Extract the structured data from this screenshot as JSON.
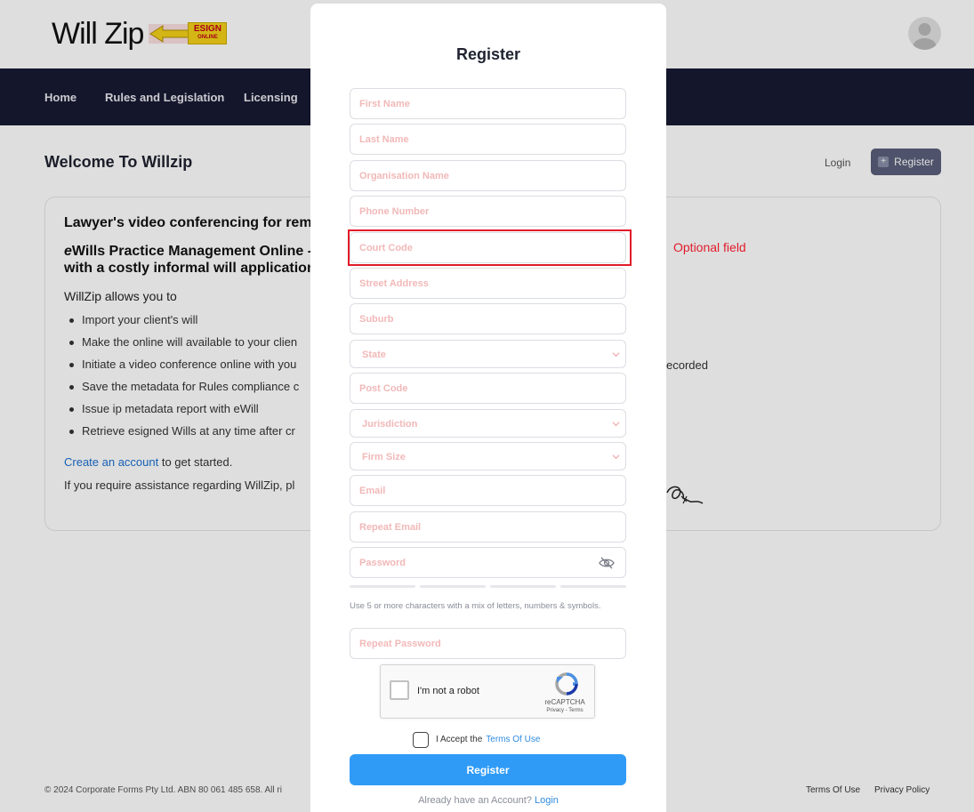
{
  "brand": {
    "logo_text": "Will Zip",
    "badge_text": "ESIGN",
    "badge_sub": "ONLINE"
  },
  "nav": {
    "items": [
      "Home",
      "Rules and Legislation",
      "Licensing"
    ]
  },
  "page": {
    "title": "Welcome To Willzip",
    "login_label": "Login",
    "register_label": "Register"
  },
  "info": {
    "heading1": "Lawyer's video conferencing for rem",
    "heading2_prefix": "e",
    "heading2_line1": "Wills Practice Management Online -",
    "heading2_line2": "with a costly informal will application",
    "allows": "WillZip allows you to",
    "bullets": [
      "Import your client's will",
      "Make the online will available to your clien",
      "Initiate a video conference online with you",
      "Save the metadata for Rules compliance c",
      "Issue ip metadata report with eWill",
      "Retrieve esigned Wills at any time after cr"
    ],
    "recorded_tail": "ecorded",
    "create_link": "Create an account",
    "create_tail": " to get started.",
    "assist": "If you require assistance regarding WillZip, pl"
  },
  "footer": {
    "copyright": "© 2024 Corporate Forms Pty Ltd. ABN 80 061 485 658. All ri",
    "terms": "Terms Of Use",
    "privacy": "Privacy Policy"
  },
  "modal": {
    "title": "Register",
    "fields": {
      "first_name": "First Name",
      "last_name": "Last Name",
      "organisation": "Organisation Name",
      "phone": "Phone Number",
      "court_code": "Court Code",
      "street": "Street Address",
      "suburb": "Suburb",
      "state": "State",
      "post_code": "Post Code",
      "jurisdiction": "Jurisdiction",
      "firm_size": "Firm Size",
      "email": "Email",
      "repeat_email": "Repeat Email",
      "password": "Password",
      "repeat_password": "Repeat Password"
    },
    "password_hint": "Use 5 or more characters with a mix of letters, numbers & symbols.",
    "captcha": {
      "label": "I'm not a robot",
      "brand": "reCAPTCHA",
      "links": "Privacy - Terms"
    },
    "accept_text": "I Accept the",
    "accept_link": "Terms Of Use",
    "submit": "Register",
    "already_text": "Already have an Account?",
    "already_link": "Login"
  },
  "annotation": {
    "label": "Optional field",
    "color": "#e11b2a"
  },
  "colors": {
    "primary": "#2f9bf7",
    "nav_bg": "#171a33",
    "placeholder": "#f2b8b8"
  }
}
